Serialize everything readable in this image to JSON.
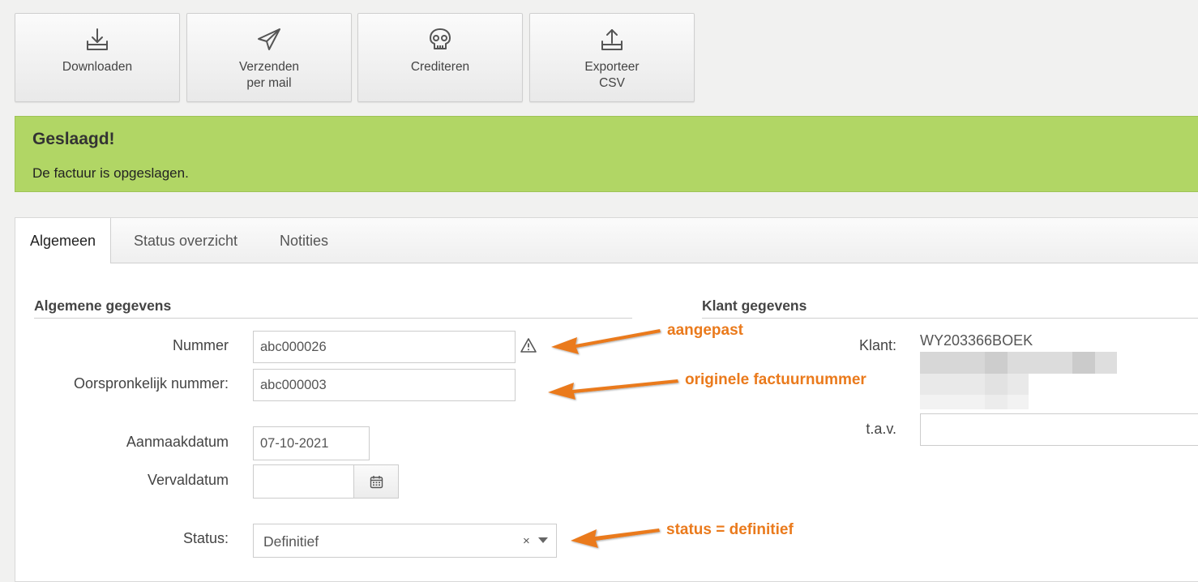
{
  "toolbar": {
    "download": {
      "label": "Downloaden",
      "icon": "download-tray-icon"
    },
    "send_mail": {
      "label": "Verzenden\nper mail",
      "icon": "paper-plane-icon"
    },
    "credit": {
      "label": "Crediteren",
      "icon": "skull-icon"
    },
    "export_csv": {
      "label": "Exporteer\nCSV",
      "icon": "upload-tray-icon"
    }
  },
  "alert": {
    "title": "Geslaagd!",
    "message": "De factuur is opgeslagen.",
    "color": "#b1d665"
  },
  "tabs": [
    {
      "label": "Algemeen",
      "active": true
    },
    {
      "label": "Status overzicht",
      "active": false
    },
    {
      "label": "Notities",
      "active": false
    }
  ],
  "general": {
    "section_title": "Algemene gegevens",
    "number_label": "Nummer",
    "number_value": "abc000026",
    "original_number_label": "Oorspronkelijk nummer:",
    "original_number_value": "abc000003",
    "created_label": "Aanmaakdatum",
    "created_value": "07-10-2021",
    "due_label": "Vervaldatum",
    "due_value": "",
    "status_label": "Status:",
    "status_value": "Definitief",
    "status_clear": "×"
  },
  "customer": {
    "section_title": "Klant gegevens",
    "customer_label": "Klant:",
    "customer_value": "WY203366BOEK",
    "attention_label": "t.a.v.",
    "attention_value": ""
  },
  "annotations": {
    "number_note": "aangepast",
    "original_note": "originele factuurnummer",
    "status_note": "status = definitief",
    "color": "#ea7a1c"
  }
}
